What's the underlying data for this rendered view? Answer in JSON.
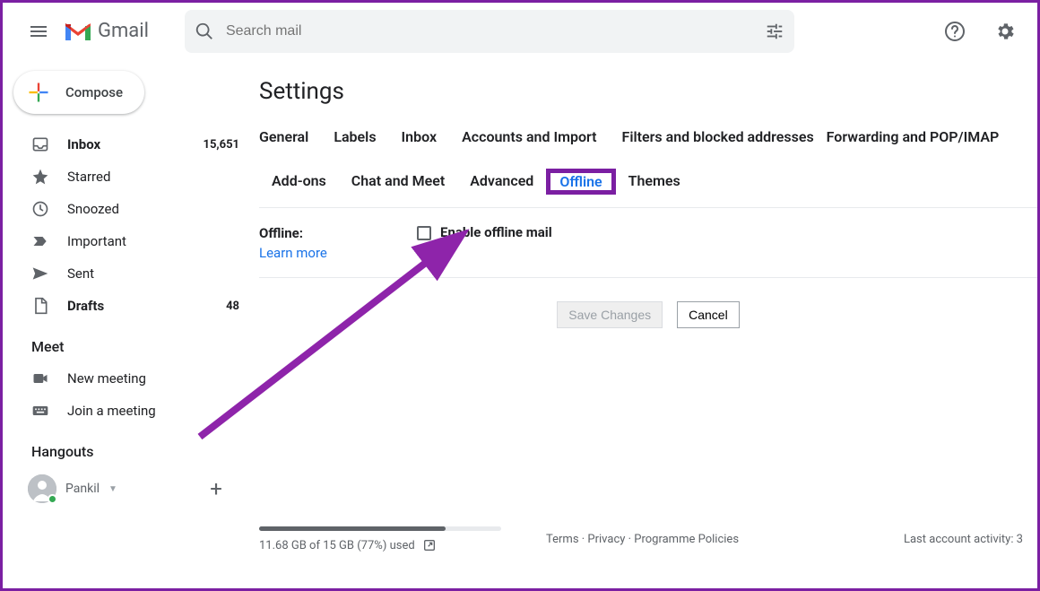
{
  "app_name": "Gmail",
  "search_placeholder": "Search mail",
  "compose_label": "Compose",
  "sidebar": {
    "items": [
      {
        "label": "Inbox",
        "count": "15,651",
        "bold": true
      },
      {
        "label": "Starred",
        "count": "",
        "bold": false
      },
      {
        "label": "Snoozed",
        "count": "",
        "bold": false
      },
      {
        "label": "Important",
        "count": "",
        "bold": false
      },
      {
        "label": "Sent",
        "count": "",
        "bold": false
      },
      {
        "label": "Drafts",
        "count": "48",
        "bold": true
      }
    ],
    "meet_title": "Meet",
    "meet_items": [
      {
        "label": "New meeting"
      },
      {
        "label": "Join a meeting"
      }
    ],
    "hangouts_title": "Hangouts",
    "hangouts_user": "Pankil"
  },
  "settings": {
    "page_title": "Settings",
    "tabs": [
      "General",
      "Labels",
      "Inbox",
      "Accounts and Import",
      "Filters and blocked addresses",
      "Forwarding and POP/IMAP",
      "Add-ons",
      "Chat and Meet",
      "Advanced",
      "Offline",
      "Themes"
    ],
    "active_tab": "Offline",
    "offline_section_title": "Offline:",
    "learn_more": "Learn more",
    "enable_label": "Enable offline mail",
    "save_label": "Save Changes",
    "cancel_label": "Cancel"
  },
  "footer": {
    "storage_used_pct": 77,
    "storage_text": "11.68 GB of 15 GB (77%) used",
    "links": [
      "Terms",
      "Privacy",
      "Programme Policies"
    ],
    "activity": "Last account activity: 3"
  },
  "colors": {
    "annotation": "#8e24aa",
    "link": "#1a73e8"
  }
}
